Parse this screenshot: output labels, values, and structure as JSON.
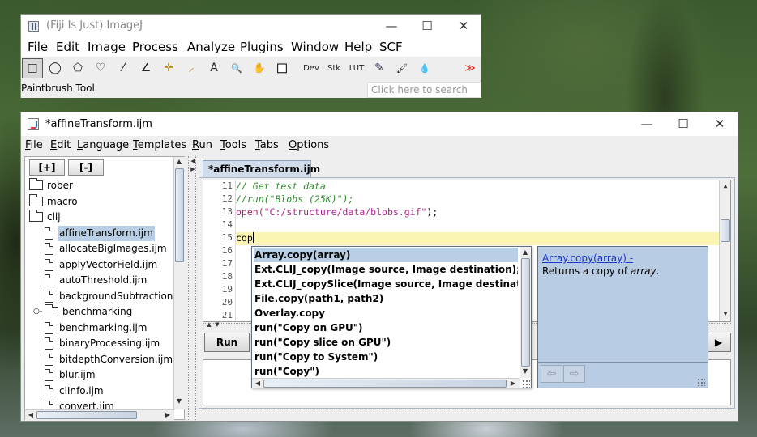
{
  "imagej": {
    "title": "(Fiji Is Just) ImageJ",
    "menu": [
      "File",
      "Edit",
      "Image",
      "Process",
      "Analyze",
      "Plugins",
      "Window",
      "Help",
      "SCF"
    ],
    "tools": {
      "rect": "□",
      "oval": "◯",
      "polygon": "⬠",
      "freehand": "♡",
      "line": "⁄",
      "angle": "∠",
      "point": "✛",
      "wand": "⸝",
      "text": "A",
      "zoom": "🔍",
      "hand": "✋",
      "dropper": "■",
      "dev": "Dev",
      "stk": "Stk",
      "lut": "LUT",
      "pencil": "✎",
      "brush": "🖌",
      "flood": "💧",
      "more": "≫"
    },
    "status": "Paintbrush Tool",
    "search_placeholder": "Click here to search"
  },
  "editor": {
    "title": "*affineTransform.ijm",
    "menu": [
      "File",
      "Edit",
      "Language",
      "Templates",
      "Run",
      "Tools",
      "Tabs",
      "Options"
    ],
    "tree_buttons": [
      "[+]",
      "[-]"
    ],
    "tree": [
      {
        "type": "folder",
        "label": "rober",
        "indent": 0
      },
      {
        "type": "folder",
        "label": "macro",
        "indent": 0
      },
      {
        "type": "folder",
        "label": "clij",
        "indent": 0
      },
      {
        "type": "file",
        "label": "affineTransform.ijm",
        "indent": 1,
        "selected": true
      },
      {
        "type": "file",
        "label": "allocateBigImages.ijm",
        "indent": 1
      },
      {
        "type": "file",
        "label": "applyVectorField.ijm",
        "indent": 1
      },
      {
        "type": "file",
        "label": "autoThreshold.ijm",
        "indent": 1
      },
      {
        "type": "file",
        "label": "backgroundSubtraction.ijm",
        "indent": 1
      },
      {
        "type": "folder",
        "label": "benchmarking",
        "indent": 1,
        "expander": true
      },
      {
        "type": "file",
        "label": "benchmarking.ijm",
        "indent": 1
      },
      {
        "type": "file",
        "label": "binaryProcessing.ijm",
        "indent": 1
      },
      {
        "type": "file",
        "label": "bitdepthConversion.ijm",
        "indent": 1
      },
      {
        "type": "file",
        "label": "blur.ijm",
        "indent": 1
      },
      {
        "type": "file",
        "label": "clInfo.ijm",
        "indent": 1
      },
      {
        "type": "file",
        "label": "convert.ijm",
        "indent": 1
      }
    ],
    "tab": "*affineTransform.ijm",
    "line_numbers": [
      "11",
      "12",
      "13",
      "14",
      "15",
      "16",
      "17",
      "18",
      "19",
      "20",
      "21"
    ],
    "code": {
      "l11": "// Get test data",
      "l12": "//run(\"Blobs (25K)\");",
      "l13_fn": "open(",
      "l13_str": "\"C:/structure/data/blobs.gif\"",
      "l13_end": ");",
      "l15": "cop"
    },
    "run_label": "Run",
    "autocomplete": [
      "Array.copy(array)",
      "Ext.CLIJ_copy(Image source, Image destination);",
      "Ext.CLIJ_copySlice(Image source, Image destination, Num",
      "File.copy(path1, path2)",
      "Overlay.copy",
      "run(\"Copy on GPU\")",
      "run(\"Copy slice on GPU\")",
      "run(\"Copy to System\")",
      "run(\"Copy\")"
    ],
    "doc": {
      "link": "Array.copy(array) -",
      "desc_prefix": "Returns a copy of ",
      "desc_em": "array",
      "desc_suffix": ".",
      "back": "⇦",
      "forward": "⇨"
    }
  },
  "colors": {
    "selection": "#b8cfe5",
    "doc_bg": "#b8cce4",
    "current_line": "#fbf5b4",
    "comment": "#2e8b2e",
    "string": "#b0208c"
  }
}
